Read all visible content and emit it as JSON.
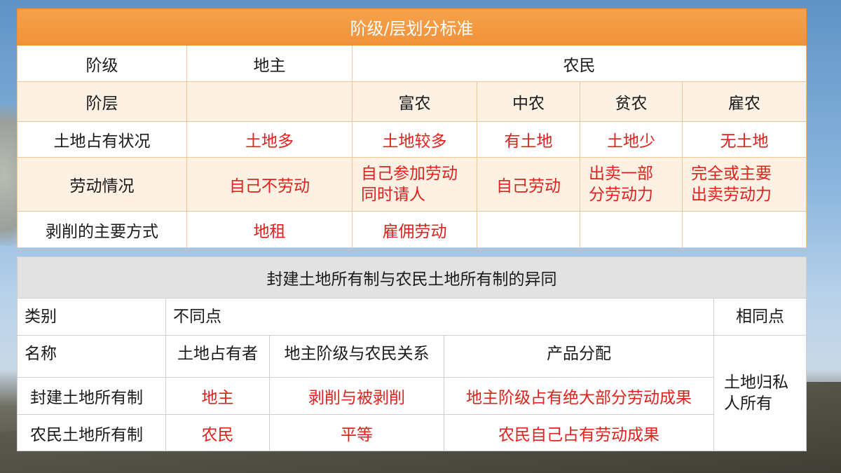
{
  "top_table": {
    "title": "阶级/层划分标准",
    "row_class": {
      "label": "阶级",
      "landlord": "地主",
      "peasant": "农民"
    },
    "row_stratum": {
      "label": "阶层",
      "landlord": "",
      "rich": "富农",
      "middle": "中农",
      "poor": "贫农",
      "hired": "雇农"
    },
    "row_land": {
      "label": "土地占有状况",
      "landlord": "土地多",
      "rich": "土地较多",
      "middle": "有土地",
      "poor": "土地少",
      "hired": "无土地"
    },
    "row_labor": {
      "label": "劳动情况",
      "landlord": "自己不劳动",
      "rich_line1": "自己参加劳动",
      "rich_line2": "同时请人",
      "middle": "自己劳动",
      "poor_line1": "出卖一部",
      "poor_line2": "分劳动力",
      "hired_line1": "完全或主要",
      "hired_line2": "出卖劳动力"
    },
    "row_exploit": {
      "label": "剥削的主要方式",
      "landlord": "地租",
      "rich": "雇佣劳动",
      "middle": "",
      "poor": "",
      "hired": ""
    }
  },
  "bottom_table": {
    "title": "封建土地所有制与农民土地所有制的异同",
    "header": {
      "category": "类别",
      "differences": "不同点",
      "similarity": "相同点"
    },
    "subheader": {
      "name": "名称",
      "owner": "土地占有者",
      "relation": "地主阶级与农民关系",
      "distribution": "产品分配"
    },
    "rows": [
      {
        "name": "封建土地所有制",
        "owner": "地主",
        "relation": "剥削与被剥削",
        "distribution": "地主阶级占有绝大部分劳动成果"
      },
      {
        "name": "农民土地所有制",
        "owner": "农民",
        "relation": "平等",
        "distribution": "农民自己占有劳动成果"
      }
    ],
    "similarity_line1": "土地归私",
    "similarity_line2": "人所有"
  }
}
